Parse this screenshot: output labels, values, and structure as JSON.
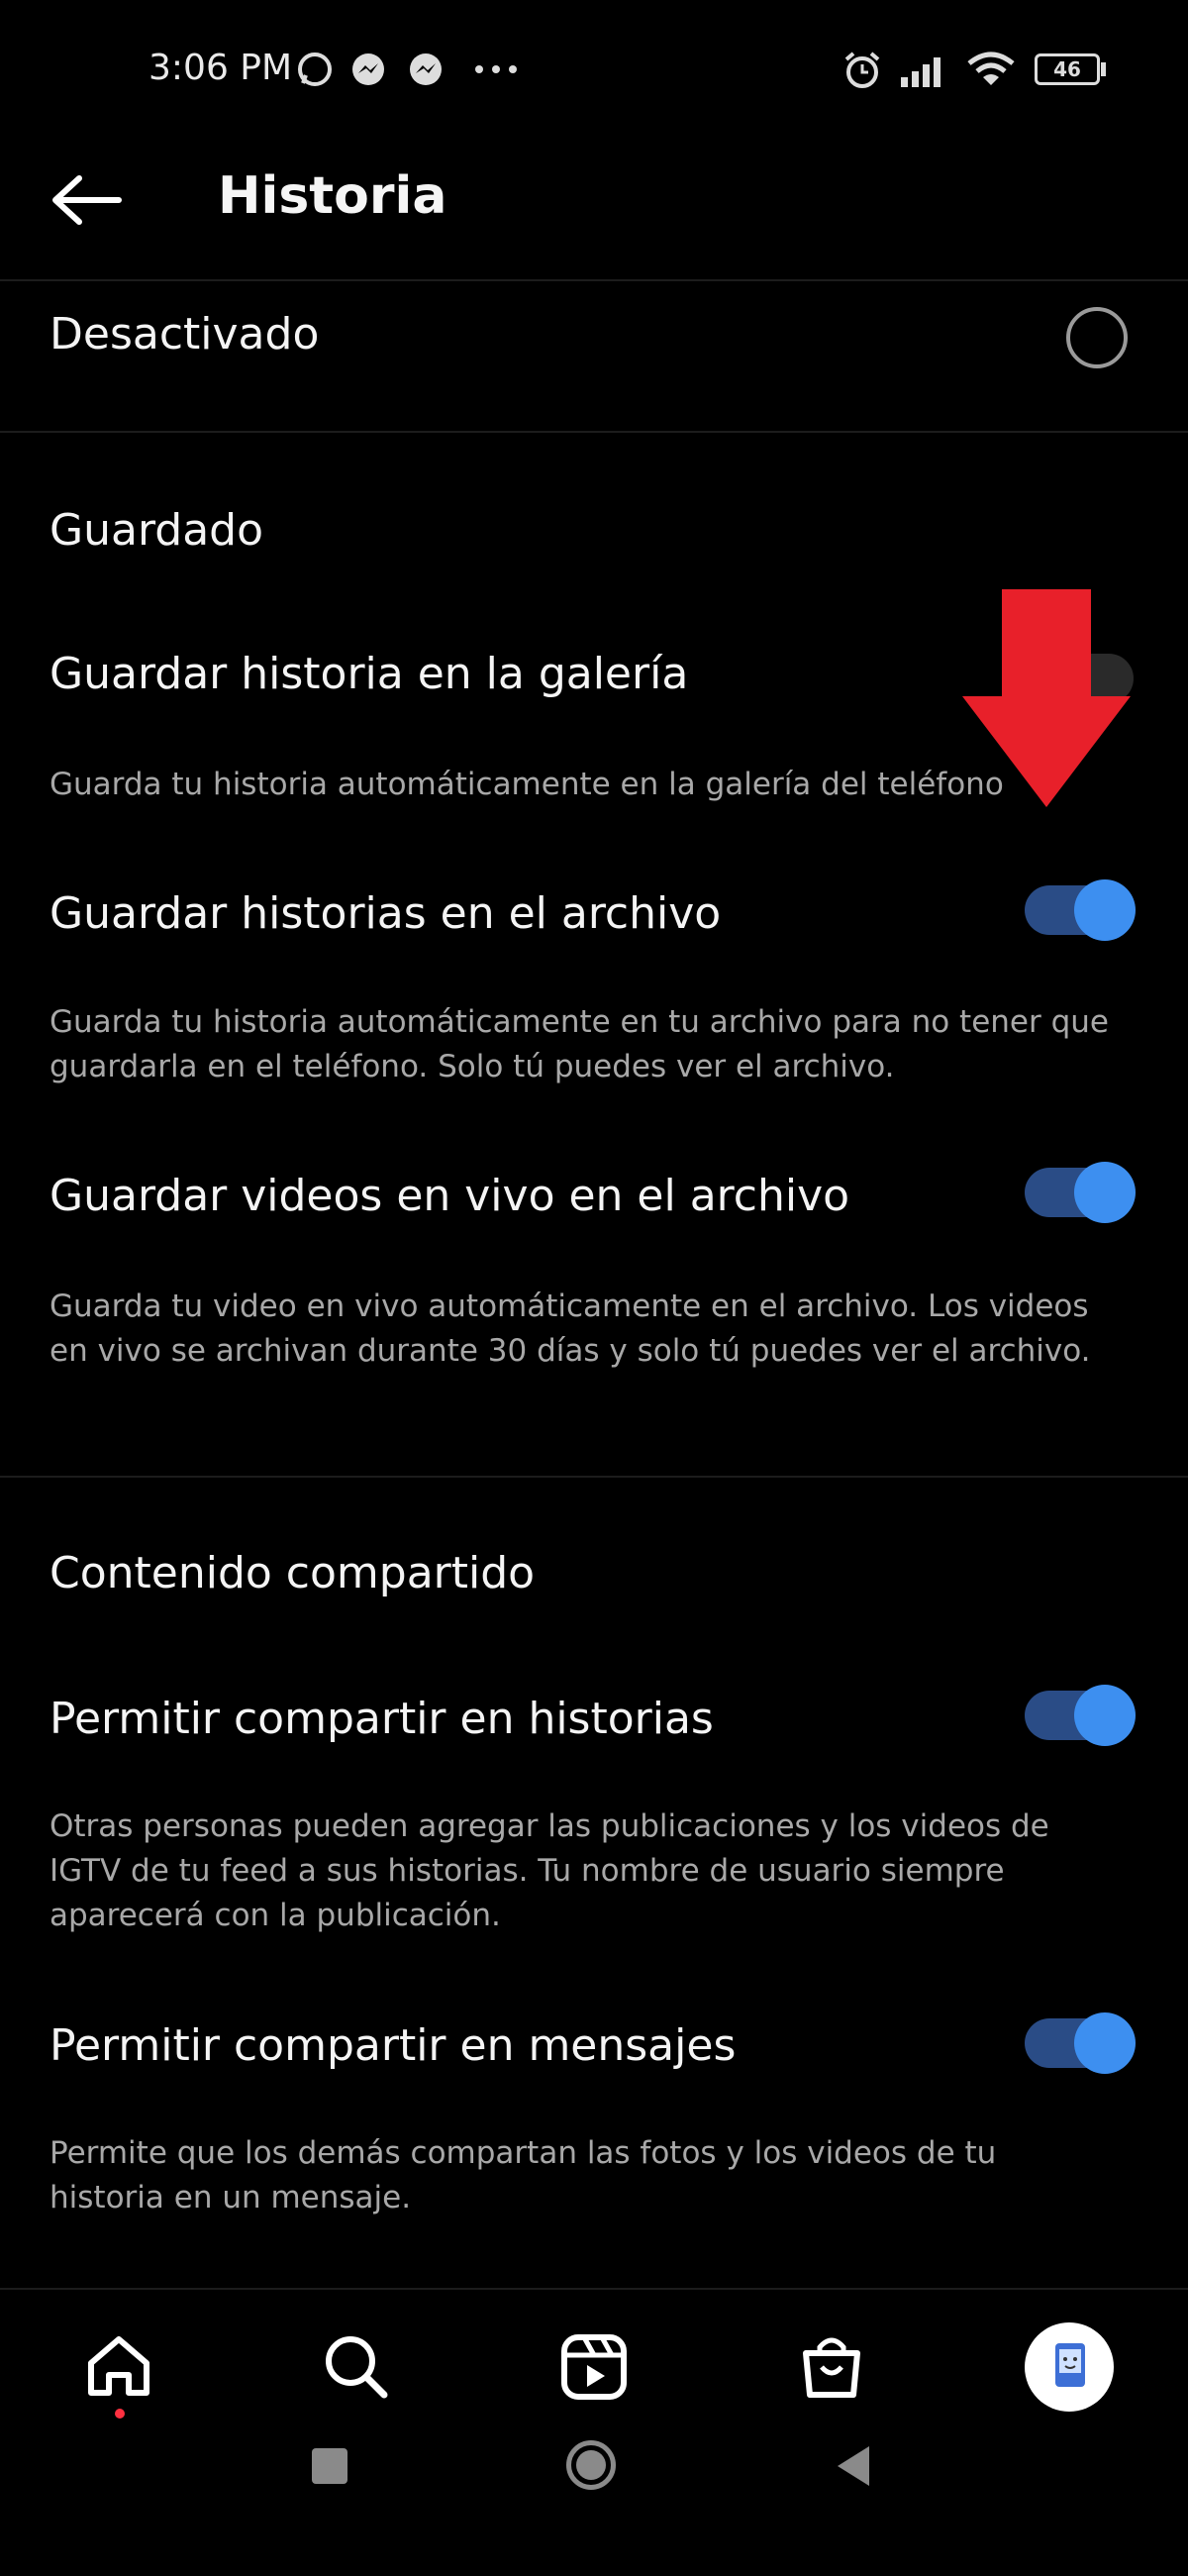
{
  "status_bar": {
    "time": "3:06 PM",
    "battery": "46",
    "icons": [
      "whatsapp-icon",
      "messenger-icon",
      "messenger-icon",
      "more-dots-icon",
      "alarm-icon",
      "signal-icon",
      "wifi-icon",
      "battery-icon"
    ]
  },
  "header": {
    "title": "Historia",
    "back_icon": "arrow-left-icon"
  },
  "settings": {
    "desactivado": {
      "label": "Desactivado"
    },
    "guardado_section": "Guardado",
    "guardar_galeria": {
      "label": "Guardar historia en la galería",
      "description": "Guarda tu historia automáticamente en la galería del teléfono",
      "enabled": false
    },
    "guardar_archivo": {
      "label": "Guardar historias en el archivo",
      "description": "Guarda tu historia automáticamente en tu archivo para no tener que guardarla en el teléfono. Solo tú puedes ver el archivo.",
      "enabled": true
    },
    "guardar_vivo": {
      "label": "Guardar videos en vivo en el archivo",
      "description": "Guarda tu video en vivo automáticamente en el archivo. Los videos en vivo se archivan durante 30 días y solo tú puedes ver el archivo.",
      "enabled": true
    },
    "contenido_section": "Contenido compartido",
    "compartir_historias": {
      "label": "Permitir compartir en historias",
      "description": "Otras personas pueden agregar las publicaciones y los videos de IGTV de tu feed a sus historias. Tu nombre de usuario siempre aparecerá con la publicación.",
      "enabled": true
    },
    "compartir_mensajes": {
      "label": "Permitir compartir en mensajes",
      "description": "Permite que los demás compartan las fotos y los videos de tu historia en un mensaje.",
      "enabled": true
    }
  },
  "bottom_nav": [
    "home-icon",
    "search-icon",
    "reels-icon",
    "shop-icon",
    "profile-avatar"
  ],
  "colors": {
    "toggle_on_knob": "#3d8ff0",
    "toggle_on_track": "#2a4c86",
    "arrow": "#e8202a",
    "notification_dot": "#ff3040"
  }
}
